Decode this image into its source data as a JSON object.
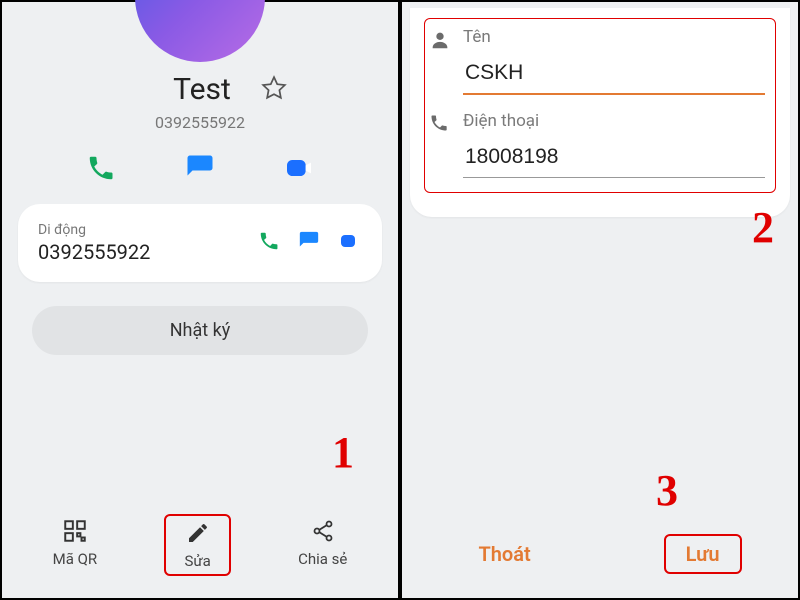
{
  "left": {
    "contact_name": "Test",
    "contact_number": "0392555922",
    "phone_card": {
      "type_label": "Di động",
      "number": "0392555922"
    },
    "log_button": "Nhật ký",
    "bottom": {
      "qr": "Mã QR",
      "edit": "Sửa",
      "share": "Chia sẻ"
    }
  },
  "right": {
    "name_label": "Tên",
    "name_value": "CSKH",
    "phone_label": "Điện thoại",
    "phone_value": "18008198",
    "footer": {
      "exit": "Thoát",
      "save": "Lưu"
    }
  },
  "steps": {
    "s1": "1",
    "s2": "2",
    "s3": "3"
  }
}
